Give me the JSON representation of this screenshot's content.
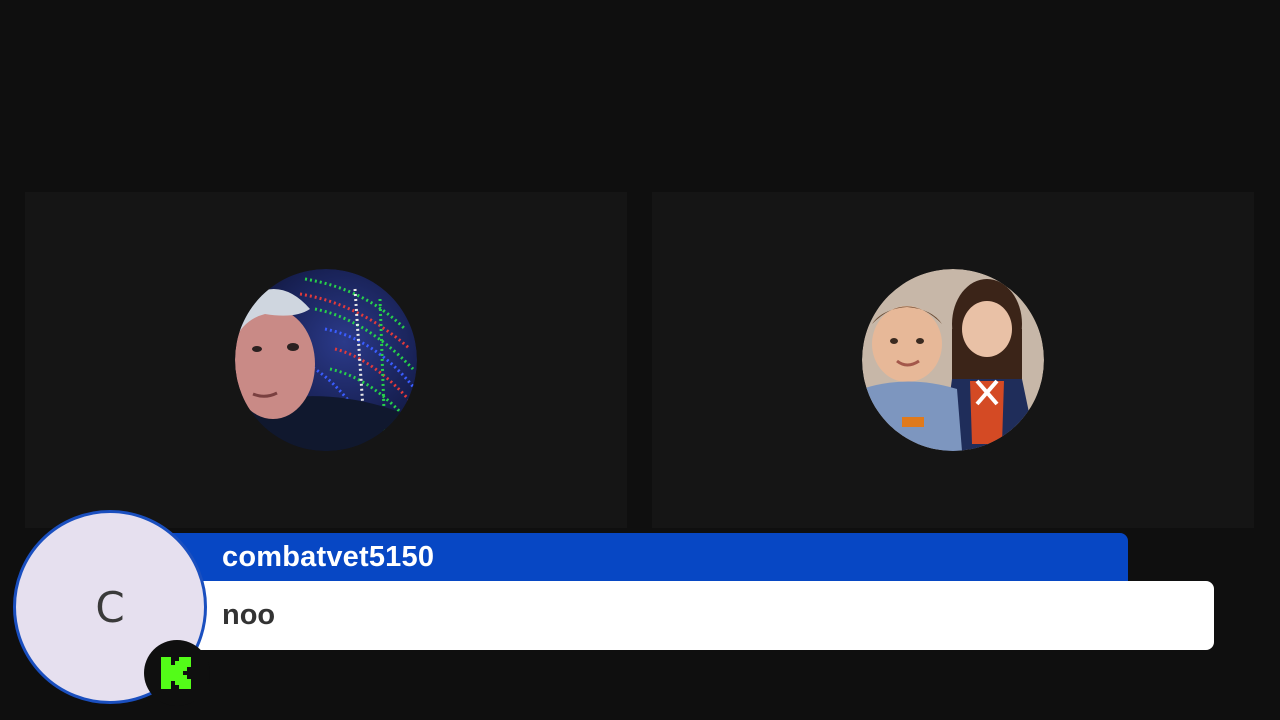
{
  "participants": [
    {
      "position": "left",
      "avatar": "photo-woman-holiday-lights"
    },
    {
      "position": "right",
      "avatar": "photo-two-children"
    }
  ],
  "chat": {
    "username": "combatvet5150",
    "message": "noo",
    "avatar_letter": "C",
    "platform_icon": "kick-icon",
    "colors": {
      "name_bar": "#0747c4",
      "avatar_bg": "#e6e0ef",
      "badge": "#53fc18"
    }
  },
  "colors": {
    "background": "#0f0f0f",
    "tile": "#151515"
  }
}
